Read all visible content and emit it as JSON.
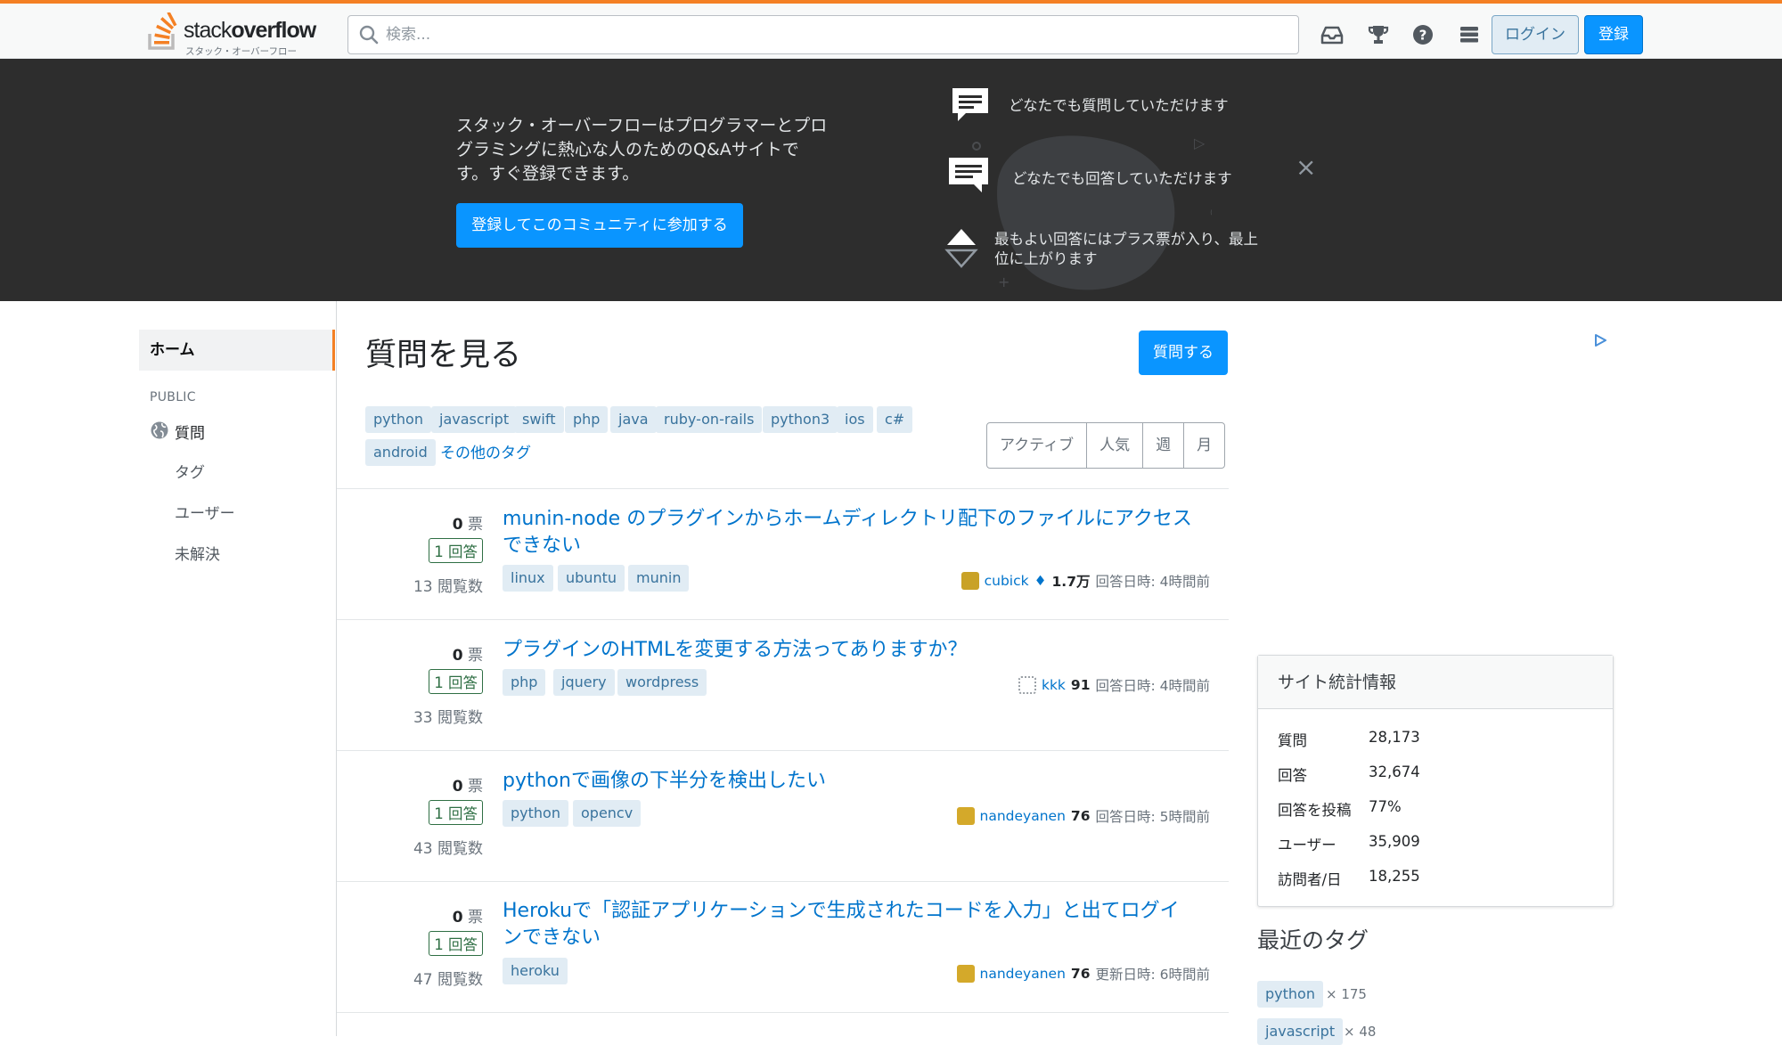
{
  "header": {
    "logo_text_light": "stack",
    "logo_text_bold": "overflow",
    "logo_subtitle": "スタック・オーバーフロー",
    "search_placeholder": "検索...",
    "icons": [
      "inbox-icon",
      "trophy-icon",
      "help-icon",
      "site-switcher-icon"
    ],
    "login_label": "ログイン",
    "signup_label": "登録"
  },
  "hero": {
    "text": "スタック・オーバーフローはプログラマーとプログラミングに熱心な人のためのQ&Aサイトです。すぐ登録できます。",
    "cta_label": "登録してこのコミュニティに参加する",
    "features": [
      {
        "icon": "question-bubble-icon",
        "text": "どなたでも質問していただけます"
      },
      {
        "icon": "answer-bubble-icon",
        "text": "どなたでも回答していただけます"
      },
      {
        "icon": "vote-arrows-icon",
        "text": "最もよい回答にはプラス票が入り、最上位に上がります"
      }
    ],
    "close_label": "×"
  },
  "leftnav": {
    "home": "ホーム",
    "public_label": "PUBLIC",
    "questions": "質問",
    "tags": "タグ",
    "users": "ユーザー",
    "unanswered": "未解決"
  },
  "main": {
    "title": "質問を見る",
    "ask_label": "質問する",
    "popular_tags": [
      "python",
      "javascript",
      "swift",
      "php",
      "java",
      "ruby-on-rails",
      "python3",
      "ios",
      "c#",
      "android"
    ],
    "more_tags_label": "その他のタグ",
    "filters": [
      "アクティブ",
      "人気",
      "週",
      "月"
    ],
    "questions": [
      {
        "votes": "0",
        "votes_unit": "票",
        "answers": "1",
        "answers_unit": "回答",
        "views": "13",
        "views_unit": "閲覧数",
        "title": "munin-node のプラグインからホームディレクトリ配下のファイルにアクセスできない",
        "tags": [
          "linux",
          "ubuntu",
          "munin"
        ],
        "user": "cubick",
        "rep": "1.7万",
        "activity": "回答日時: 4時間前",
        "avatar_color": "#c9a227",
        "has_diamond": true
      },
      {
        "votes": "0",
        "votes_unit": "票",
        "answers": "1",
        "answers_unit": "回答",
        "views": "33",
        "views_unit": "閲覧数",
        "title": "プラグインのHTMLを変更する方法ってありますか？",
        "tags": [
          "php",
          "jquery",
          "wordpress"
        ],
        "user": "kkk",
        "rep": "91",
        "activity": "回答日時: 4時間前",
        "avatar_color": "#9aa0a6",
        "has_diamond": false
      },
      {
        "votes": "0",
        "votes_unit": "票",
        "answers": "1",
        "answers_unit": "回答",
        "views": "43",
        "views_unit": "閲覧数",
        "title": "pythonで画像の下半分を検出したい",
        "tags": [
          "python",
          "opencv"
        ],
        "user": "nandeyanen",
        "rep": "76",
        "activity": "回答日時: 5時間前",
        "avatar_color": "#d4a92a",
        "has_diamond": false
      },
      {
        "votes": "0",
        "votes_unit": "票",
        "answers": "1",
        "answers_unit": "回答",
        "views": "47",
        "views_unit": "閲覧数",
        "title": "Herokuで「認証アプリケーションで生成されたコードを入力」と出てログインできない",
        "tags": [
          "heroku"
        ],
        "user": "nandeyanen",
        "rep": "76",
        "activity": "更新日時: 6時間前",
        "avatar_color": "#d4a92a",
        "has_diamond": false
      }
    ]
  },
  "sidebar": {
    "stats_title": "サイト統計情報",
    "stats": [
      {
        "label": "質問",
        "value": "28,173"
      },
      {
        "label": "回答",
        "value": "32,674"
      },
      {
        "label": "回答を投稿",
        "value": "77%"
      },
      {
        "label": "ユーザー",
        "value": "35,909"
      },
      {
        "label": "訪問者/日",
        "value": "18,255"
      }
    ],
    "recent_tags_title": "最近のタグ",
    "recent_tags": [
      {
        "name": "python",
        "count": "× 175"
      },
      {
        "name": "javascript",
        "count": "× 48"
      }
    ]
  },
  "colors": {
    "accent_orange": "#f48024",
    "primary_blue": "#0a95ff",
    "link_blue": "#0074cc",
    "tag_bg": "#e1ecf4",
    "answered_green": "#2f6f44",
    "hero_bg": "#2d2d2d"
  }
}
